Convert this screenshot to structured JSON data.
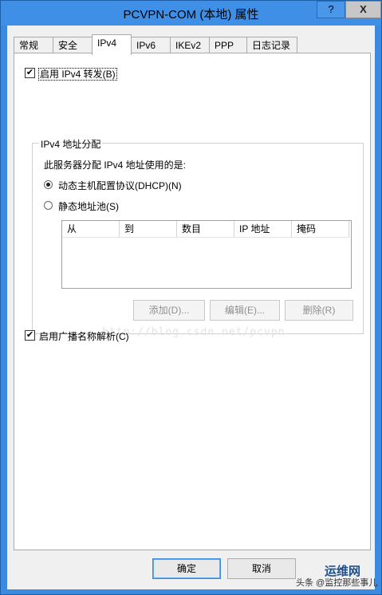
{
  "window": {
    "title": "PCVPN-COM (本地) 属性",
    "help_label": "?",
    "close_label": "X"
  },
  "tabs": [
    {
      "label": "常规"
    },
    {
      "label": "安全"
    },
    {
      "label": "IPv4"
    },
    {
      "label": "IPv6"
    },
    {
      "label": "IKEv2"
    },
    {
      "label": "PPP"
    },
    {
      "label": "日志记录"
    }
  ],
  "active_tab": "IPv4",
  "ipv4": {
    "enable_forwarding": {
      "label": "启用 IPv4 转发(B)",
      "checked": true
    },
    "group": {
      "title": "IPv4 地址分配",
      "description": "此服务器分配 IPv4 地址使用的是:",
      "dhcp_option": {
        "label": "动态主机配置协议(DHCP)(N)",
        "selected": true
      },
      "static_option": {
        "label": "静态地址池(S)",
        "selected": false
      },
      "columns": [
        "从",
        "到",
        "数目",
        "IP 地址",
        "掩码"
      ],
      "buttons": {
        "add": "添加(D)...",
        "edit": "编辑(E)...",
        "delete": "删除(R)"
      }
    },
    "enable_broadcast": {
      "label": "启用广播名称解析(C)",
      "checked": true
    }
  },
  "watermark": "http://blog.csdn.net/pcvpn",
  "footer": {
    "ok": "确定",
    "cancel": "取消"
  },
  "brand": {
    "name": "运维网",
    "sub": "头条 @监控那些事儿"
  }
}
